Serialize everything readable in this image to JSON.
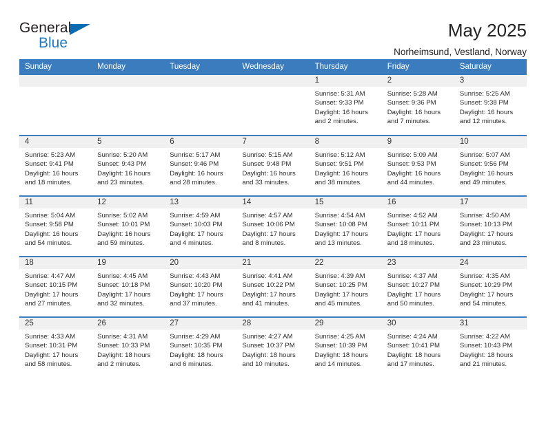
{
  "logo": {
    "word_top": "General",
    "word_bottom": "Blue",
    "triangle_color": "#0b6cb2",
    "blue_color": "#1f7ac0"
  },
  "header": {
    "title": "May 2025",
    "subtitle": "Norheimsund, Vestland, Norway"
  },
  "theme": {
    "header_blue": "#3a7cbd",
    "daynum_strip": "#f0f0f0"
  },
  "calendar": {
    "weekday_headers": [
      "Sunday",
      "Monday",
      "Tuesday",
      "Wednesday",
      "Thursday",
      "Friday",
      "Saturday"
    ],
    "weeks": [
      [
        {
          "day": "",
          "empty": true
        },
        {
          "day": "",
          "empty": true
        },
        {
          "day": "",
          "empty": true
        },
        {
          "day": "",
          "empty": true
        },
        {
          "day": "1",
          "sunrise": "Sunrise: 5:31 AM",
          "sunset": "Sunset: 9:33 PM",
          "daylight_1": "Daylight: 16 hours",
          "daylight_2": "and 2 minutes."
        },
        {
          "day": "2",
          "sunrise": "Sunrise: 5:28 AM",
          "sunset": "Sunset: 9:36 PM",
          "daylight_1": "Daylight: 16 hours",
          "daylight_2": "and 7 minutes."
        },
        {
          "day": "3",
          "sunrise": "Sunrise: 5:25 AM",
          "sunset": "Sunset: 9:38 PM",
          "daylight_1": "Daylight: 16 hours",
          "daylight_2": "and 12 minutes."
        }
      ],
      [
        {
          "day": "4",
          "sunrise": "Sunrise: 5:23 AM",
          "sunset": "Sunset: 9:41 PM",
          "daylight_1": "Daylight: 16 hours",
          "daylight_2": "and 18 minutes."
        },
        {
          "day": "5",
          "sunrise": "Sunrise: 5:20 AM",
          "sunset": "Sunset: 9:43 PM",
          "daylight_1": "Daylight: 16 hours",
          "daylight_2": "and 23 minutes."
        },
        {
          "day": "6",
          "sunrise": "Sunrise: 5:17 AM",
          "sunset": "Sunset: 9:46 PM",
          "daylight_1": "Daylight: 16 hours",
          "daylight_2": "and 28 minutes."
        },
        {
          "day": "7",
          "sunrise": "Sunrise: 5:15 AM",
          "sunset": "Sunset: 9:48 PM",
          "daylight_1": "Daylight: 16 hours",
          "daylight_2": "and 33 minutes."
        },
        {
          "day": "8",
          "sunrise": "Sunrise: 5:12 AM",
          "sunset": "Sunset: 9:51 PM",
          "daylight_1": "Daylight: 16 hours",
          "daylight_2": "and 38 minutes."
        },
        {
          "day": "9",
          "sunrise": "Sunrise: 5:09 AM",
          "sunset": "Sunset: 9:53 PM",
          "daylight_1": "Daylight: 16 hours",
          "daylight_2": "and 44 minutes."
        },
        {
          "day": "10",
          "sunrise": "Sunrise: 5:07 AM",
          "sunset": "Sunset: 9:56 PM",
          "daylight_1": "Daylight: 16 hours",
          "daylight_2": "and 49 minutes."
        }
      ],
      [
        {
          "day": "11",
          "sunrise": "Sunrise: 5:04 AM",
          "sunset": "Sunset: 9:58 PM",
          "daylight_1": "Daylight: 16 hours",
          "daylight_2": "and 54 minutes."
        },
        {
          "day": "12",
          "sunrise": "Sunrise: 5:02 AM",
          "sunset": "Sunset: 10:01 PM",
          "daylight_1": "Daylight: 16 hours",
          "daylight_2": "and 59 minutes."
        },
        {
          "day": "13",
          "sunrise": "Sunrise: 4:59 AM",
          "sunset": "Sunset: 10:03 PM",
          "daylight_1": "Daylight: 17 hours",
          "daylight_2": "and 4 minutes."
        },
        {
          "day": "14",
          "sunrise": "Sunrise: 4:57 AM",
          "sunset": "Sunset: 10:06 PM",
          "daylight_1": "Daylight: 17 hours",
          "daylight_2": "and 8 minutes."
        },
        {
          "day": "15",
          "sunrise": "Sunrise: 4:54 AM",
          "sunset": "Sunset: 10:08 PM",
          "daylight_1": "Daylight: 17 hours",
          "daylight_2": "and 13 minutes."
        },
        {
          "day": "16",
          "sunrise": "Sunrise: 4:52 AM",
          "sunset": "Sunset: 10:11 PM",
          "daylight_1": "Daylight: 17 hours",
          "daylight_2": "and 18 minutes."
        },
        {
          "day": "17",
          "sunrise": "Sunrise: 4:50 AM",
          "sunset": "Sunset: 10:13 PM",
          "daylight_1": "Daylight: 17 hours",
          "daylight_2": "and 23 minutes."
        }
      ],
      [
        {
          "day": "18",
          "sunrise": "Sunrise: 4:47 AM",
          "sunset": "Sunset: 10:15 PM",
          "daylight_1": "Daylight: 17 hours",
          "daylight_2": "and 27 minutes."
        },
        {
          "day": "19",
          "sunrise": "Sunrise: 4:45 AM",
          "sunset": "Sunset: 10:18 PM",
          "daylight_1": "Daylight: 17 hours",
          "daylight_2": "and 32 minutes."
        },
        {
          "day": "20",
          "sunrise": "Sunrise: 4:43 AM",
          "sunset": "Sunset: 10:20 PM",
          "daylight_1": "Daylight: 17 hours",
          "daylight_2": "and 37 minutes."
        },
        {
          "day": "21",
          "sunrise": "Sunrise: 4:41 AM",
          "sunset": "Sunset: 10:22 PM",
          "daylight_1": "Daylight: 17 hours",
          "daylight_2": "and 41 minutes."
        },
        {
          "day": "22",
          "sunrise": "Sunrise: 4:39 AM",
          "sunset": "Sunset: 10:25 PM",
          "daylight_1": "Daylight: 17 hours",
          "daylight_2": "and 45 minutes."
        },
        {
          "day": "23",
          "sunrise": "Sunrise: 4:37 AM",
          "sunset": "Sunset: 10:27 PM",
          "daylight_1": "Daylight: 17 hours",
          "daylight_2": "and 50 minutes."
        },
        {
          "day": "24",
          "sunrise": "Sunrise: 4:35 AM",
          "sunset": "Sunset: 10:29 PM",
          "daylight_1": "Daylight: 17 hours",
          "daylight_2": "and 54 minutes."
        }
      ],
      [
        {
          "day": "25",
          "sunrise": "Sunrise: 4:33 AM",
          "sunset": "Sunset: 10:31 PM",
          "daylight_1": "Daylight: 17 hours",
          "daylight_2": "and 58 minutes."
        },
        {
          "day": "26",
          "sunrise": "Sunrise: 4:31 AM",
          "sunset": "Sunset: 10:33 PM",
          "daylight_1": "Daylight: 18 hours",
          "daylight_2": "and 2 minutes."
        },
        {
          "day": "27",
          "sunrise": "Sunrise: 4:29 AM",
          "sunset": "Sunset: 10:35 PM",
          "daylight_1": "Daylight: 18 hours",
          "daylight_2": "and 6 minutes."
        },
        {
          "day": "28",
          "sunrise": "Sunrise: 4:27 AM",
          "sunset": "Sunset: 10:37 PM",
          "daylight_1": "Daylight: 18 hours",
          "daylight_2": "and 10 minutes."
        },
        {
          "day": "29",
          "sunrise": "Sunrise: 4:25 AM",
          "sunset": "Sunset: 10:39 PM",
          "daylight_1": "Daylight: 18 hours",
          "daylight_2": "and 14 minutes."
        },
        {
          "day": "30",
          "sunrise": "Sunrise: 4:24 AM",
          "sunset": "Sunset: 10:41 PM",
          "daylight_1": "Daylight: 18 hours",
          "daylight_2": "and 17 minutes."
        },
        {
          "day": "31",
          "sunrise": "Sunrise: 4:22 AM",
          "sunset": "Sunset: 10:43 PM",
          "daylight_1": "Daylight: 18 hours",
          "daylight_2": "and 21 minutes."
        }
      ]
    ]
  }
}
